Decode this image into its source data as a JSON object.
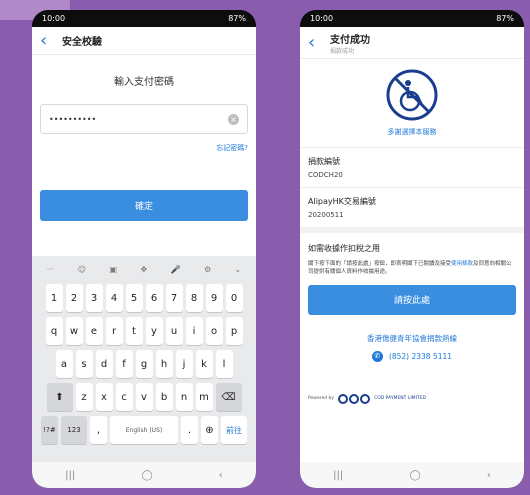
{
  "left_phone": {
    "status": {
      "time": "10:00",
      "right": "87%"
    },
    "appbar": {
      "back": "‹",
      "title": "安全校驗"
    },
    "heading": "輸入支付密碼",
    "password": {
      "value": "••••••••••"
    },
    "forgot": "忘記密碼?",
    "confirm": "確定",
    "keyboard": {
      "top": [
        "···",
        "☺",
        "▣",
        "✥",
        "🎤",
        "⚙",
        "⌄"
      ],
      "row_numbers": [
        "1",
        "2",
        "3",
        "4",
        "5",
        "6",
        "7",
        "8",
        "9",
        "0"
      ],
      "row1": [
        "q",
        "w",
        "e",
        "r",
        "t",
        "y",
        "u",
        "i",
        "o",
        "p"
      ],
      "row2": [
        "a",
        "s",
        "d",
        "f",
        "g",
        "h",
        "j",
        "k",
        "l"
      ],
      "row3": [
        "z",
        "x",
        "c",
        "v",
        "b",
        "n",
        "m"
      ],
      "shift": "⬆",
      "backspace": "⌫",
      "sym": "!?#",
      "num": "123",
      "comma": ",",
      "space": "English (US)",
      "period": ".",
      "globe": "⊕",
      "action": "前往"
    },
    "nav": [
      "|||",
      "◯",
      "‹"
    ]
  },
  "right_phone": {
    "status": {
      "time": "10:00",
      "right": "87%"
    },
    "appbar": {
      "back": "‹",
      "title": "支付成功",
      "sub": "捐款成功"
    },
    "logo_caption": "多謝選擇本服務",
    "donation_no": {
      "label": "捐款編號",
      "value": "CODCH20"
    },
    "alipay_no": {
      "label": "AlipayHK交易編號",
      "value": "20200511"
    },
    "tax": {
      "title": "如需收據作扣稅之用",
      "body_1": "閣下按下面的「請按此處」按鈕，即表明閣下已閱讀及接受",
      "link": "使用條款",
      "body_2": "及同意向相關公司提供有關個人資料作收據用途。"
    },
    "click_button": "請按此處",
    "org_name": "香港傷健青年協會捐款熱線",
    "hotline": "(852) 2338 5111",
    "powered": {
      "prefix": "Powered by",
      "name": "COD PAYMENT LIMITED"
    },
    "nav": [
      "|||",
      "◯",
      "‹"
    ]
  }
}
